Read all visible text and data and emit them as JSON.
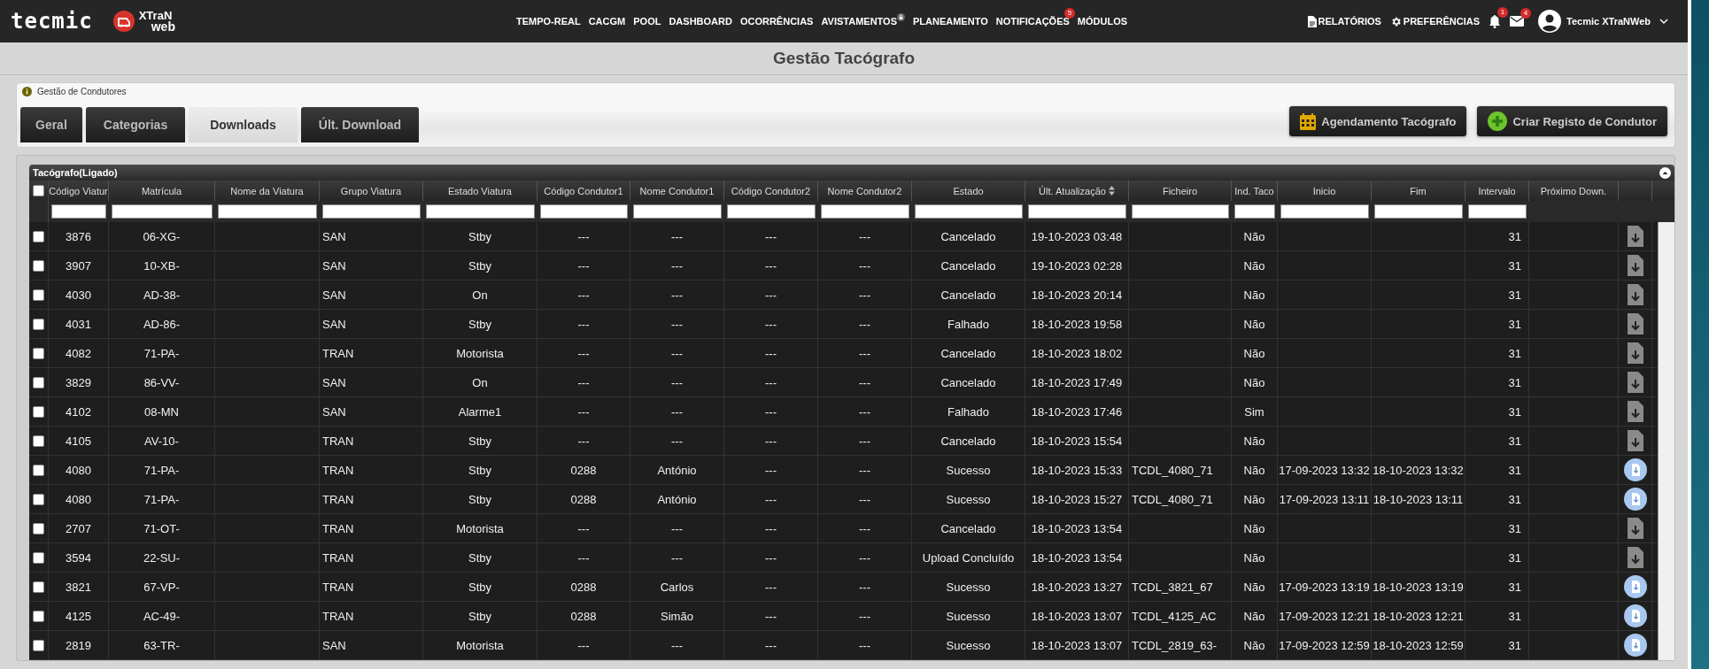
{
  "header": {
    "logo": "tecmic",
    "product_logo": [
      "XTraN",
      "web"
    ],
    "nav": [
      {
        "label": "TEMPO-REAL",
        "locked": false
      },
      {
        "label": "CACGM",
        "locked": false
      },
      {
        "label": "POOL",
        "locked": false
      },
      {
        "label": "DASHBOARD",
        "locked": false
      },
      {
        "label": "OCORRÊNCIAS",
        "locked": false
      },
      {
        "label": "AVISTAMENTOS",
        "locked": true
      },
      {
        "label": "PLANEAMENTO",
        "locked": false
      },
      {
        "label": "NOTIFICAÇÕES",
        "locked": false,
        "badge": "5"
      },
      {
        "label": "MÓDULOS",
        "locked": false
      }
    ],
    "reports": "RELATÓRIOS",
    "preferences": "PREFERÊNCIAS",
    "alerts_badge": "1",
    "messages_badge": "4",
    "user": "Tecmic XTraNWeb"
  },
  "page_title": "Gestão Tacógrafo",
  "breadcrumb": "Gestão de Condutores",
  "tabs": [
    {
      "label": "Geral",
      "selected": false
    },
    {
      "label": "Categorias",
      "selected": false
    },
    {
      "label": "Downloads",
      "selected": true
    },
    {
      "label": "Últ. Download",
      "selected": false
    }
  ],
  "buttons": [
    "Agendamento Tacógrafo",
    "Criar Registo de Condutor"
  ],
  "table": {
    "caption": "Tacógrafo(Ligado)",
    "all_selected": false,
    "columns": [
      {
        "label": "Código Viatur",
        "filter": true,
        "sort_icon": false
      },
      {
        "label": "Matrícula",
        "filter": true,
        "sort_icon": false
      },
      {
        "label": "Nome da Viatura",
        "filter": true,
        "sort_icon": false
      },
      {
        "label": "Grupo Viatura",
        "filter": true,
        "sort_icon": false
      },
      {
        "label": "Estado Viatura",
        "filter": true,
        "sort_icon": false
      },
      {
        "label": "Código Condutor1",
        "filter": true,
        "sort_icon": false
      },
      {
        "label": "Nome Condutor1",
        "filter": true,
        "sort_icon": false
      },
      {
        "label": "Código Condutor2",
        "filter": true,
        "sort_icon": false
      },
      {
        "label": "Nome Condutor2",
        "filter": true,
        "sort_icon": false
      },
      {
        "label": "Estado",
        "filter": true,
        "sort_icon": false
      },
      {
        "label": "Últ. Atualização",
        "filter": true,
        "sort_icon": true
      },
      {
        "label": "Ficheiro",
        "filter": true,
        "sort_icon": false
      },
      {
        "label": "Ind. Taco",
        "filter": true,
        "sort_icon": false
      },
      {
        "label": "Inicio",
        "filter": true,
        "sort_icon": false
      },
      {
        "label": "Fim",
        "filter": true,
        "sort_icon": false
      },
      {
        "label": "Intervalo",
        "filter": true,
        "sort_icon": false
      },
      {
        "label": "Próximo Down.",
        "filter": false,
        "sort_icon": false
      }
    ],
    "rows": [
      {
        "checked": false,
        "file_ready": false,
        "code": "3876",
        "plate": "06-XG-",
        "group": "SAN",
        "vehicle_state": "Stby",
        "driver1_code": "---",
        "driver1_name": "---",
        "driver2_code": "---",
        "driver2_name": "---",
        "state": "Cancelado",
        "updated": "19-10-2023 03:48",
        "tacho": "Não",
        "interval": "31"
      },
      {
        "checked": false,
        "file_ready": false,
        "code": "3907",
        "plate": "10-XB-",
        "group": "SAN",
        "vehicle_state": "Stby",
        "driver1_code": "---",
        "driver1_name": "---",
        "driver2_code": "---",
        "driver2_name": "---",
        "state": "Cancelado",
        "updated": "19-10-2023 02:28",
        "tacho": "Não",
        "interval": "31"
      },
      {
        "checked": false,
        "file_ready": false,
        "code": "4030",
        "plate": "AD-38-",
        "group": "SAN",
        "vehicle_state": "On",
        "driver1_code": "---",
        "driver1_name": "---",
        "driver2_code": "---",
        "driver2_name": "---",
        "state": "Cancelado",
        "updated": "18-10-2023 20:14",
        "tacho": "Não",
        "interval": "31"
      },
      {
        "checked": false,
        "file_ready": false,
        "code": "4031",
        "plate": "AD-86-",
        "group": "SAN",
        "vehicle_state": "Stby",
        "driver1_code": "---",
        "driver1_name": "---",
        "driver2_code": "---",
        "driver2_name": "---",
        "state": "Falhado",
        "updated": "18-10-2023 19:58",
        "tacho": "Não",
        "interval": "31"
      },
      {
        "checked": false,
        "file_ready": false,
        "code": "4082",
        "plate": "71-PA-",
        "group": "TRAN",
        "vehicle_state": "Motorista",
        "driver1_code": "---",
        "driver1_name": "---",
        "driver2_code": "---",
        "driver2_name": "---",
        "state": "Cancelado",
        "updated": "18-10-2023 18:02",
        "tacho": "Não",
        "interval": "31"
      },
      {
        "checked": false,
        "file_ready": false,
        "code": "3829",
        "plate": "86-VV-",
        "group": "SAN",
        "vehicle_state": "On",
        "driver1_code": "---",
        "driver1_name": "---",
        "driver2_code": "---",
        "driver2_name": "---",
        "state": "Cancelado",
        "updated": "18-10-2023 17:49",
        "tacho": "Não",
        "interval": "31"
      },
      {
        "checked": false,
        "file_ready": false,
        "code": "4102",
        "plate": "08-MN",
        "group": "SAN",
        "vehicle_state": "Alarme1",
        "driver1_code": "---",
        "driver1_name": "---",
        "driver2_code": "---",
        "driver2_name": "---",
        "state": "Falhado",
        "updated": "18-10-2023 17:46",
        "tacho": "Sim",
        "interval": "31"
      },
      {
        "checked": false,
        "file_ready": false,
        "code": "4105",
        "plate": "AV-10-",
        "group": "TRAN",
        "vehicle_state": "Stby",
        "driver1_code": "---",
        "driver1_name": "---",
        "driver2_code": "---",
        "driver2_name": "---",
        "state": "Cancelado",
        "updated": "18-10-2023 15:54",
        "tacho": "Não",
        "interval": "31"
      },
      {
        "checked": false,
        "file_ready": true,
        "code": "4080",
        "plate": "71-PA-",
        "group": "TRAN",
        "vehicle_state": "Stby",
        "driver1_code": "0288",
        "driver1_name": "António",
        "driver2_code": "---",
        "driver2_name": "---",
        "state": "Sucesso",
        "updated": "18-10-2023 15:33",
        "file": "TCDL_4080_71",
        "tacho": "Não",
        "start": "17-09-2023 13:32",
        "end": "18-10-2023 13:32",
        "interval": "31"
      },
      {
        "checked": false,
        "file_ready": true,
        "code": "4080",
        "plate": "71-PA-",
        "group": "TRAN",
        "vehicle_state": "Stby",
        "driver1_code": "0288",
        "driver1_name": "António",
        "driver2_code": "---",
        "driver2_name": "---",
        "state": "Sucesso",
        "updated": "18-10-2023 15:27",
        "file": "TCDL_4080_71",
        "tacho": "Não",
        "start": "17-09-2023 13:11",
        "end": "18-10-2023 13:11",
        "interval": "31"
      },
      {
        "checked": false,
        "file_ready": false,
        "code": "2707",
        "plate": "71-OT-",
        "group": "TRAN",
        "vehicle_state": "Motorista",
        "driver1_code": "---",
        "driver1_name": "---",
        "driver2_code": "---",
        "driver2_name": "---",
        "state": "Cancelado",
        "updated": "18-10-2023 13:54",
        "tacho": "Não",
        "interval": "31"
      },
      {
        "checked": false,
        "file_ready": false,
        "code": "3594",
        "plate": "22-SU-",
        "group": "TRAN",
        "vehicle_state": "Stby",
        "driver1_code": "---",
        "driver1_name": "---",
        "driver2_code": "---",
        "driver2_name": "---",
        "state": "Upload Concluído",
        "updated": "18-10-2023 13:54",
        "tacho": "Não",
        "interval": "31"
      },
      {
        "checked": false,
        "file_ready": true,
        "code": "3821",
        "plate": "67-VP-",
        "group": "TRAN",
        "vehicle_state": "Stby",
        "driver1_code": "0288",
        "driver1_name": "Carlos",
        "driver2_code": "---",
        "driver2_name": "---",
        "state": "Sucesso",
        "updated": "18-10-2023 13:27",
        "file": "TCDL_3821_67",
        "tacho": "Não",
        "start": "17-09-2023 13:19",
        "end": "18-10-2023 13:19",
        "interval": "31"
      },
      {
        "checked": false,
        "file_ready": true,
        "code": "4125",
        "plate": "AC-49-",
        "group": "TRAN",
        "vehicle_state": "Stby",
        "driver1_code": "0288",
        "driver1_name": "Simão",
        "driver2_code": "---",
        "driver2_name": "---",
        "state": "Sucesso",
        "updated": "18-10-2023 13:07",
        "file": "TCDL_4125_AC",
        "tacho": "Não",
        "start": "17-09-2023 12:21",
        "end": "18-10-2023 12:21",
        "interval": "31"
      },
      {
        "checked": false,
        "file_ready": true,
        "code": "2819",
        "plate": "63-TR-",
        "group": "SAN",
        "vehicle_state": "Motorista",
        "driver1_code": "---",
        "driver1_name": "---",
        "driver2_code": "---",
        "driver2_name": "---",
        "state": "Sucesso",
        "updated": "18-10-2023 13:07",
        "file": "TCDL_2819_63-",
        "tacho": "Não",
        "start": "17-09-2023 12:59",
        "end": "18-10-2023 12:59",
        "interval": "31"
      }
    ]
  }
}
